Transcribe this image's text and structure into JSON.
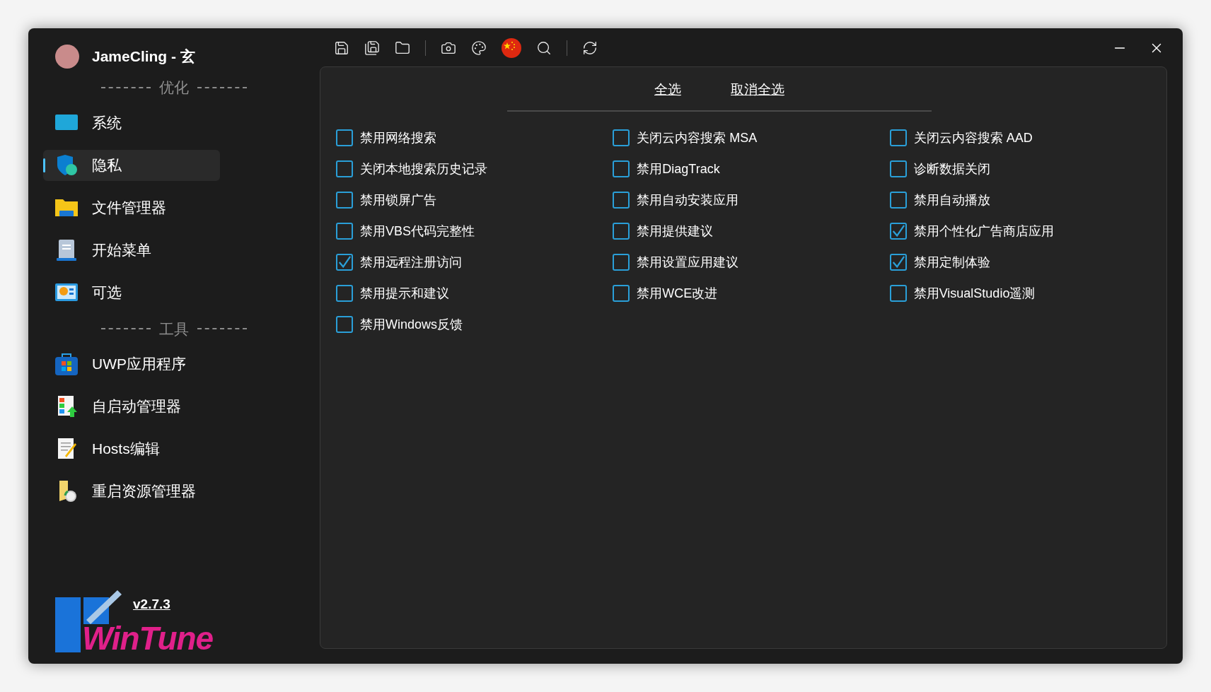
{
  "user": {
    "name": "JameCling - 玄"
  },
  "sidebar": {
    "sections": [
      {
        "heading": "优化",
        "items": [
          {
            "label": "系统",
            "kind": "system",
            "selected": false
          },
          {
            "label": "隐私",
            "kind": "privacy",
            "selected": true
          },
          {
            "label": "文件管理器",
            "kind": "folder",
            "selected": false
          },
          {
            "label": "开始菜单",
            "kind": "start",
            "selected": false
          },
          {
            "label": "可选",
            "kind": "optional",
            "selected": false
          }
        ]
      },
      {
        "heading": "工具",
        "items": [
          {
            "label": "UWP应用程序",
            "kind": "store",
            "selected": false
          },
          {
            "label": "自启动管理器",
            "kind": "startup",
            "selected": false
          },
          {
            "label": "Hosts编辑",
            "kind": "hosts",
            "selected": false
          },
          {
            "label": "重启资源管理器",
            "kind": "restart",
            "selected": false
          }
        ]
      }
    ]
  },
  "footer": {
    "version": "v2.7.3",
    "logo": "WinTune"
  },
  "actions": [
    "全选",
    "取消全选"
  ],
  "options": [
    {
      "label": "禁用网络搜索",
      "checked": false
    },
    {
      "label": "关闭云内容搜索 MSA",
      "checked": false
    },
    {
      "label": "关闭云内容搜索 AAD",
      "checked": false
    },
    {
      "label": "关闭本地搜索历史记录",
      "checked": false
    },
    {
      "label": "禁用DiagTrack",
      "checked": false
    },
    {
      "label": "诊断数据关闭",
      "checked": false
    },
    {
      "label": "禁用锁屏广告",
      "checked": false
    },
    {
      "label": "禁用自动安装应用",
      "checked": false
    },
    {
      "label": "禁用自动播放",
      "checked": false
    },
    {
      "label": "禁用VBS代码完整性",
      "checked": false
    },
    {
      "label": "禁用提供建议",
      "checked": false
    },
    {
      "label": "禁用个性化广告商店应用",
      "checked": true
    },
    {
      "label": "禁用远程注册访问",
      "checked": true
    },
    {
      "label": "禁用设置应用建议",
      "checked": false
    },
    {
      "label": "禁用定制体验",
      "checked": true
    },
    {
      "label": "禁用提示和建议",
      "checked": false
    },
    {
      "label": "禁用WCE改进",
      "checked": false
    },
    {
      "label": "禁用VisualStudio遥测",
      "checked": false
    },
    {
      "label": "禁用Windows反馈",
      "checked": false
    }
  ]
}
